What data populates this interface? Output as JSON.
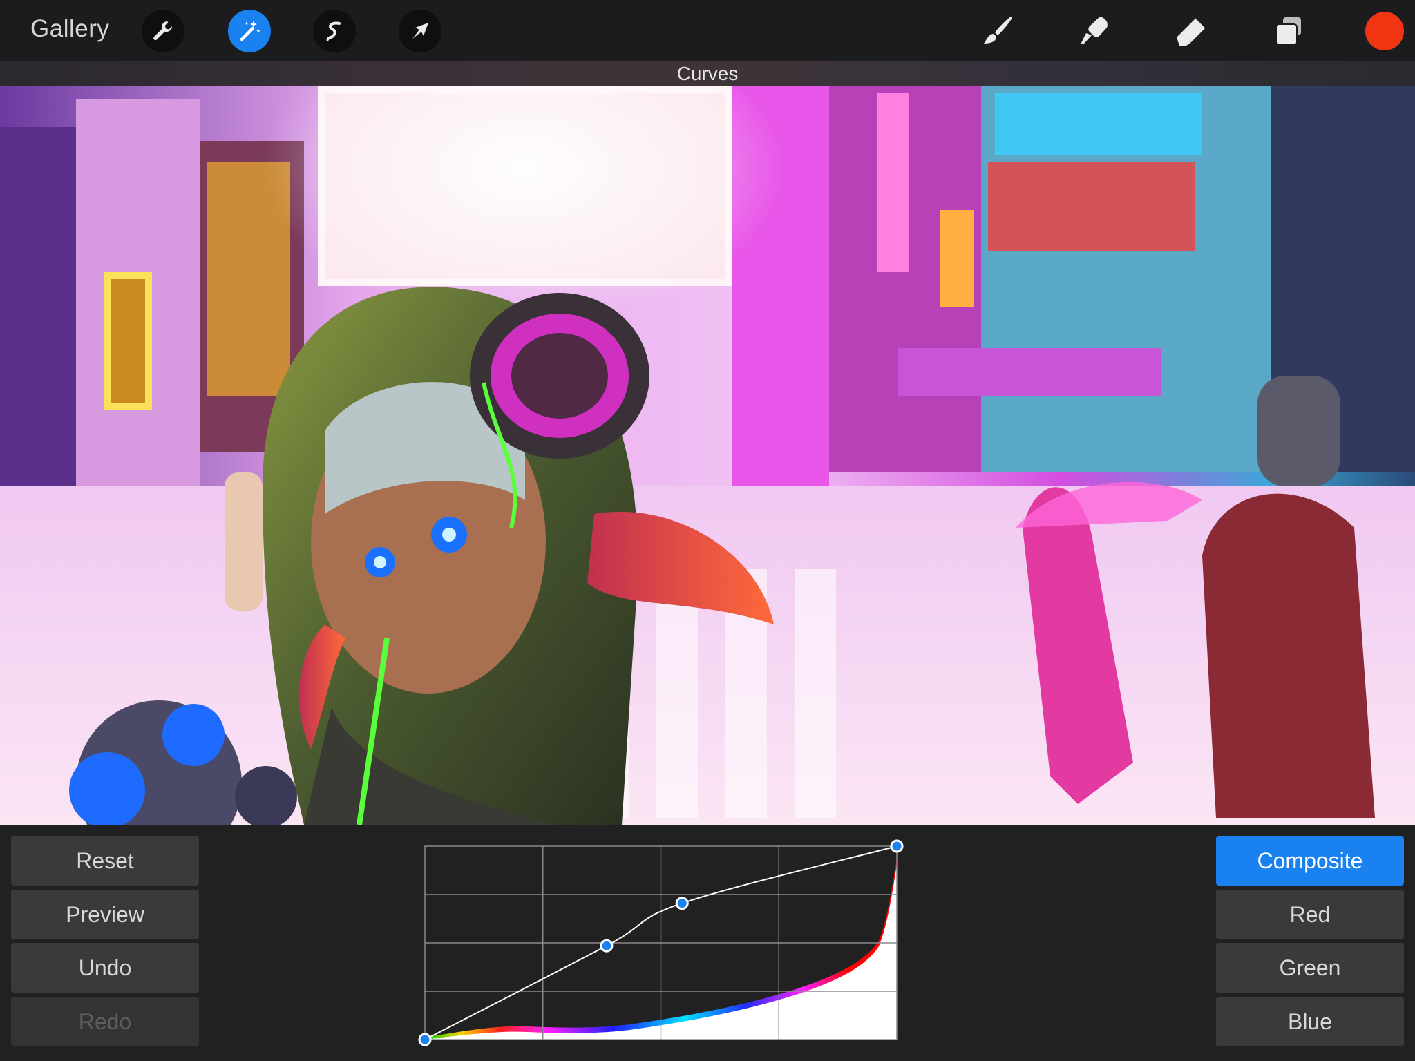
{
  "toolbar": {
    "gallery_label": "Gallery",
    "left_tools": [
      {
        "icon": "wrench-icon",
        "active": false
      },
      {
        "icon": "magic-wand-icon",
        "active": true
      },
      {
        "icon": "selection-icon",
        "active": false
      },
      {
        "icon": "transform-arrow-icon",
        "active": false
      }
    ],
    "right_tools": [
      "brush-icon",
      "smudge-icon",
      "eraser-icon",
      "layers-icon"
    ],
    "current_color": "#f13512"
  },
  "adjustment": {
    "title": "Curves"
  },
  "actions": {
    "reset": "Reset",
    "preview": "Preview",
    "undo": "Undo",
    "redo": "Redo"
  },
  "channels": {
    "selected": "Composite",
    "items": [
      "Composite",
      "Red",
      "Green",
      "Blue"
    ]
  },
  "curve": {
    "points": [
      [
        0,
        0
      ],
      [
        0.385,
        0.485
      ],
      [
        0.545,
        0.705
      ],
      [
        1,
        1
      ]
    ],
    "grid_divisions": 4
  },
  "colors": {
    "accent": "#1a82f0",
    "toolbar_bg": "#1c1c1e",
    "panel_bg": "#212121",
    "button_bg": "#3a3a3a"
  }
}
